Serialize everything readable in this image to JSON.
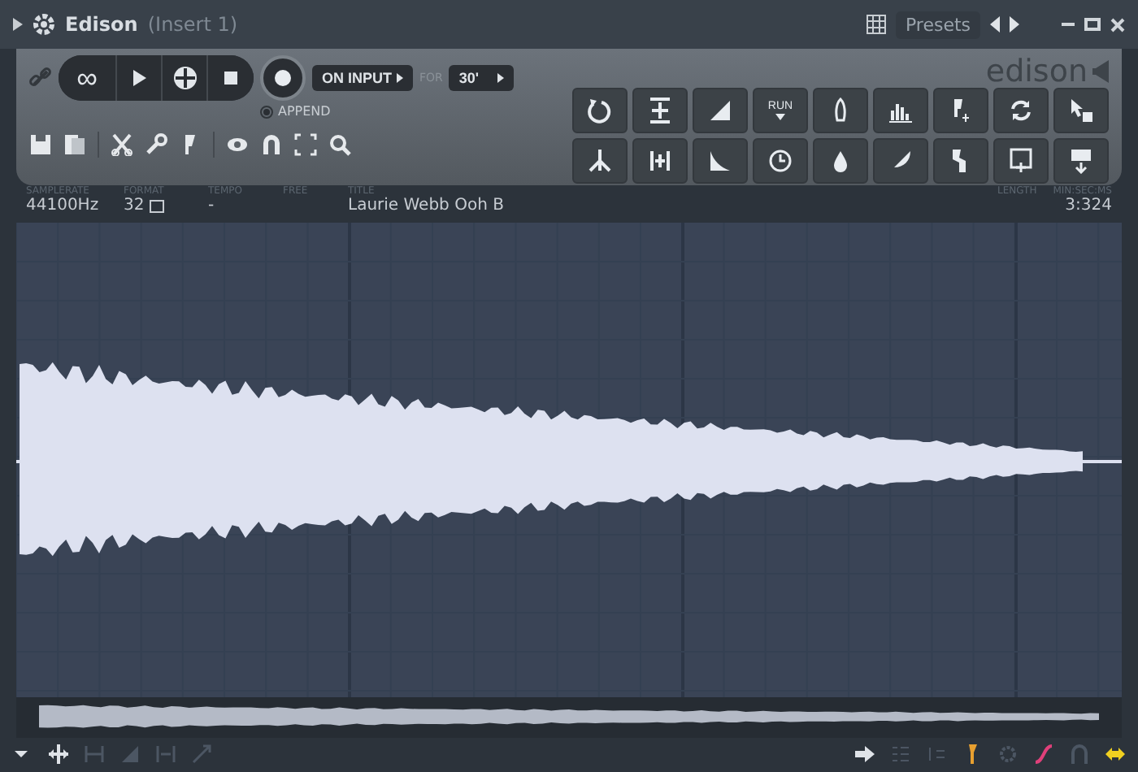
{
  "window": {
    "title": "Edison",
    "subtitle": "(Insert 1)",
    "presets": "Presets"
  },
  "transport": {
    "loop_symbol": "∞",
    "record_mode": "ON INPUT",
    "for_label": "FOR",
    "for_value": "30'",
    "append": {
      "label": "APPEND",
      "checked": true
    }
  },
  "logo": "edison",
  "tool_grid": {
    "run_label": "RUN"
  },
  "info": [
    {
      "label": "SAMPLERATE",
      "value": "44100Hz"
    },
    {
      "label": "FORMAT",
      "value": "32"
    },
    {
      "label": "TEMPO",
      "value": "-"
    },
    {
      "label": "FREE"
    },
    {
      "label": "TITLE",
      "value": "Laurie Webb Ooh B"
    }
  ],
  "length": {
    "label": "LENGTH",
    "unit": "MIN:SEC:MS",
    "value": "3:324"
  },
  "bottom_left": [
    {
      "disabled": false
    },
    {
      "disabled": false
    },
    {
      "disabled": true
    },
    {
      "disabled": true
    },
    {
      "disabled": true
    },
    {
      "disabled": true
    }
  ],
  "bottom_right": [
    {
      "disabled": false
    },
    {
      "disabled": true
    },
    {
      "disabled": true
    },
    {
      "disabled": false
    },
    {
      "disabled": true
    },
    {
      "disabled": false
    },
    {
      "disabled": true
    },
    {
      "disabled": false
    }
  ]
}
